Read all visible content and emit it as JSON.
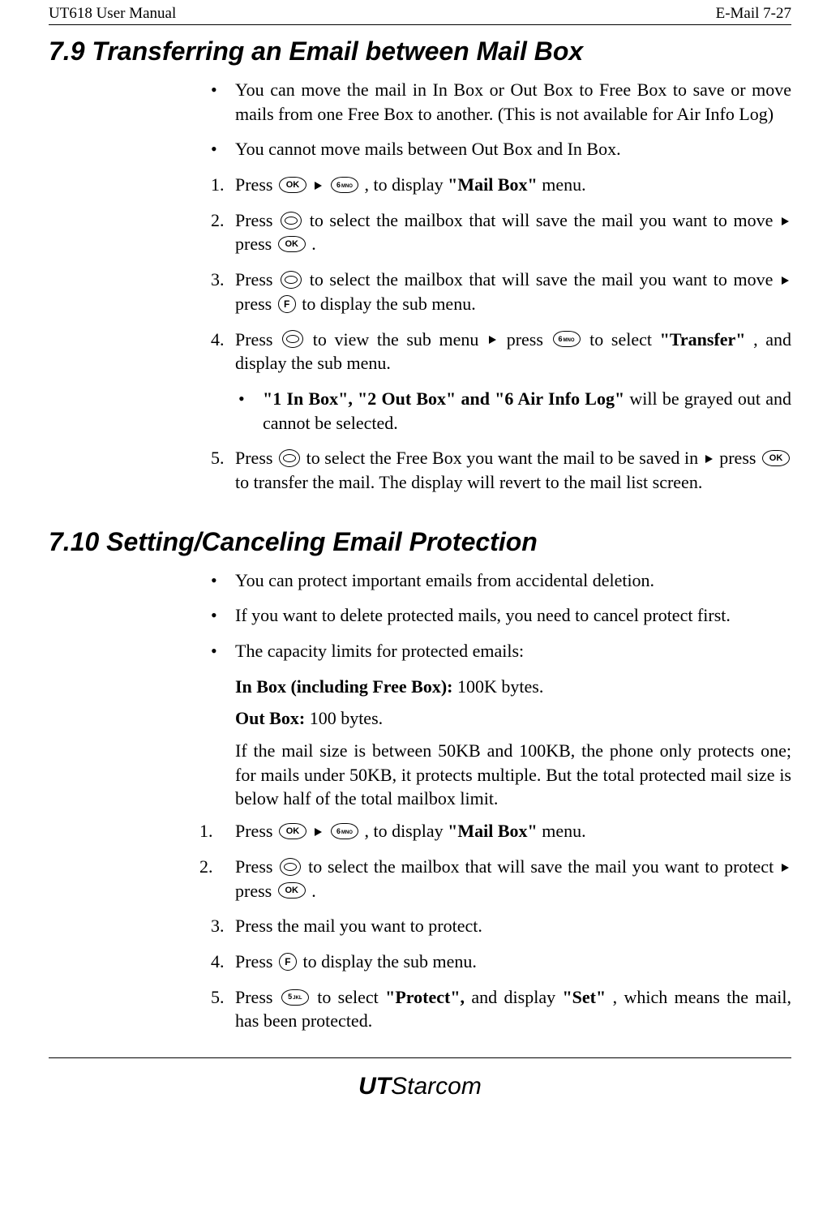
{
  "header": {
    "left": "UT618 User Manual",
    "right": "E-Mail   7-27"
  },
  "section_7_9": {
    "title": "7.9   Transferring an Email between Mail Box",
    "bullets": [
      "You can move the mail in In Box or Out Box to Free Box to save or move mails from one Free Box to another. (This is not available for Air Info Log)",
      "You cannot move mails between Out Box and In Box."
    ],
    "steps": {
      "1": {
        "pre": "Press ",
        "mid1": ", to display ",
        "bold1": "\"Mail Box\"",
        "post": " menu."
      },
      "2": {
        "pre": "Press ",
        "mid": " to select the mailbox that will save the mail you want to move",
        "cont": "press ",
        "post": "."
      },
      "3": {
        "pre": "Press ",
        "mid": " to select the mailbox that will save the mail you want to move ",
        "cont": "press ",
        "post": " to display the sub menu."
      },
      "4": {
        "pre": "Press ",
        "mid1": " to view the sub menu ",
        "mid2": " press ",
        "mid3": " to select ",
        "bold": "\"Transfer\"",
        "post": ", and display the sub menu."
      },
      "4sub": {
        "bold": "\"1 In Box\", \"2 Out Box\" and \"6 Air Info Log\"",
        "text": " will be grayed out and cannot be selected."
      },
      "5": {
        "pre": "Press ",
        "mid": " to select the Free Box you want the mail to be saved in ",
        "mid2": " press ",
        "post": " to transfer the mail. The display will revert to the mail list screen."
      }
    }
  },
  "section_7_10": {
    "title": "7.10 Setting/Canceling Email Protection",
    "bullets": [
      "You can protect important emails from accidental deletion.",
      "If you want to delete protected mails, you need to cancel protect first.",
      "The capacity limits for protected emails:"
    ],
    "capacity": {
      "in_box_label": "In Box (including Free Box): ",
      "in_box_value": "100K bytes.",
      "out_box_label": "Out Box: ",
      "out_box_value": "100 bytes.",
      "note": "If the mail size is between 50KB and 100KB, the phone only protects one; for mails under 50KB, it protects multiple. But the total protected mail size is below half of the total mailbox limit."
    },
    "steps": {
      "1": {
        "pre": "Press ",
        "mid": ", to display ",
        "bold": "\"Mail Box\"",
        "post": " menu."
      },
      "2": {
        "pre": "Press ",
        "mid": " to select the mailbox that will save the mail you want to protect ",
        "cont": "press ",
        "post": "."
      },
      "3": "Press the mail you want to protect.",
      "4": {
        "pre": "Press ",
        "post": " to display the sub menu."
      },
      "5": {
        "pre": "Press ",
        "mid1": " to select ",
        "bold1": "\"Protect\",",
        "mid2": " and display ",
        "bold2": "\"Set\"",
        "post": ", which means the mail, has been protected."
      }
    }
  },
  "footer": {
    "logo_a": "UT",
    "logo_b": "Starcom"
  },
  "keys": {
    "ok": "OK",
    "six": "6",
    "six_sub": "MNO",
    "five": "5",
    "five_sub": "JKL",
    "f": "F"
  }
}
